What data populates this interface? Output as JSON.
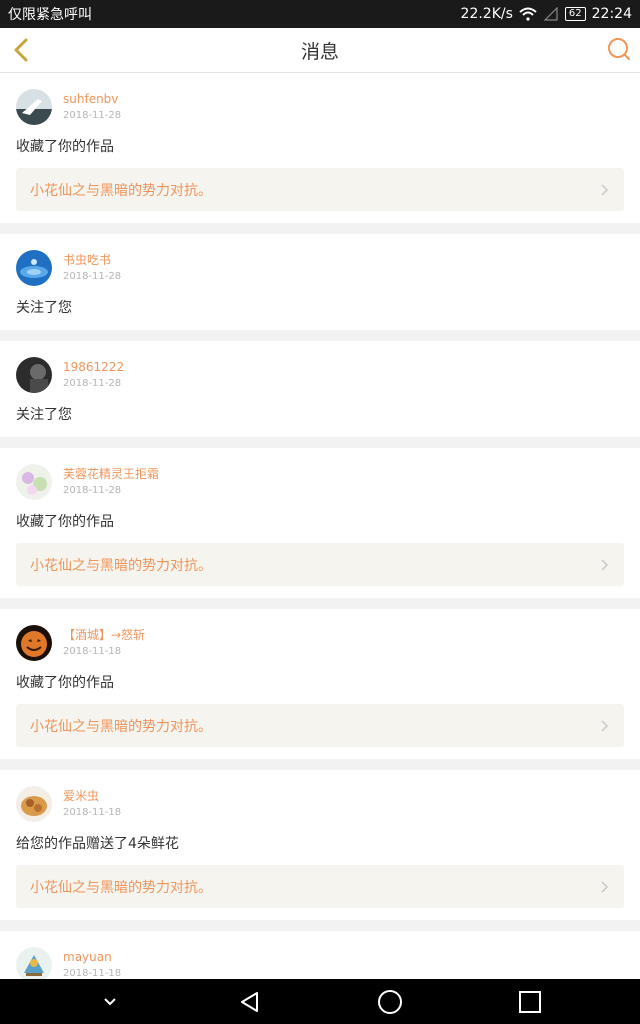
{
  "status_bar": {
    "carrier": "仅限紧急呼叫",
    "speed": "22.2K/s",
    "battery": "62",
    "time": "22:24"
  },
  "header": {
    "title": "消息"
  },
  "colors": {
    "accent": "#f0955a",
    "card_bg": "#f5f4ef",
    "page_bg": "#f2f2f2"
  },
  "messages": [
    {
      "user": "suhfenbv",
      "date": "2018-11-28",
      "action": "收藏了你的作品",
      "work": "小花仙之与黑暗的势力对抗。"
    },
    {
      "user": "书虫吃书",
      "date": "2018-11-28",
      "action": "关注了您"
    },
    {
      "user": "19861222",
      "date": "2018-11-28",
      "action": "关注了您"
    },
    {
      "user": "芙蓉花精灵王拒霜",
      "date": "2018-11-28",
      "action": "收藏了你的作品",
      "work": "小花仙之与黑暗的势力对抗。"
    },
    {
      "user": "【酒城】→怒斩",
      "date": "2018-11-18",
      "action": "收藏了你的作品",
      "work": "小花仙之与黑暗的势力对抗。"
    },
    {
      "user": "爱米虫",
      "date": "2018-11-18",
      "action": "给您的作品赠送了4朵鲜花",
      "work": "小花仙之与黑暗的势力对抗。"
    },
    {
      "user": "mayuan",
      "date": "2018-11-18"
    }
  ]
}
